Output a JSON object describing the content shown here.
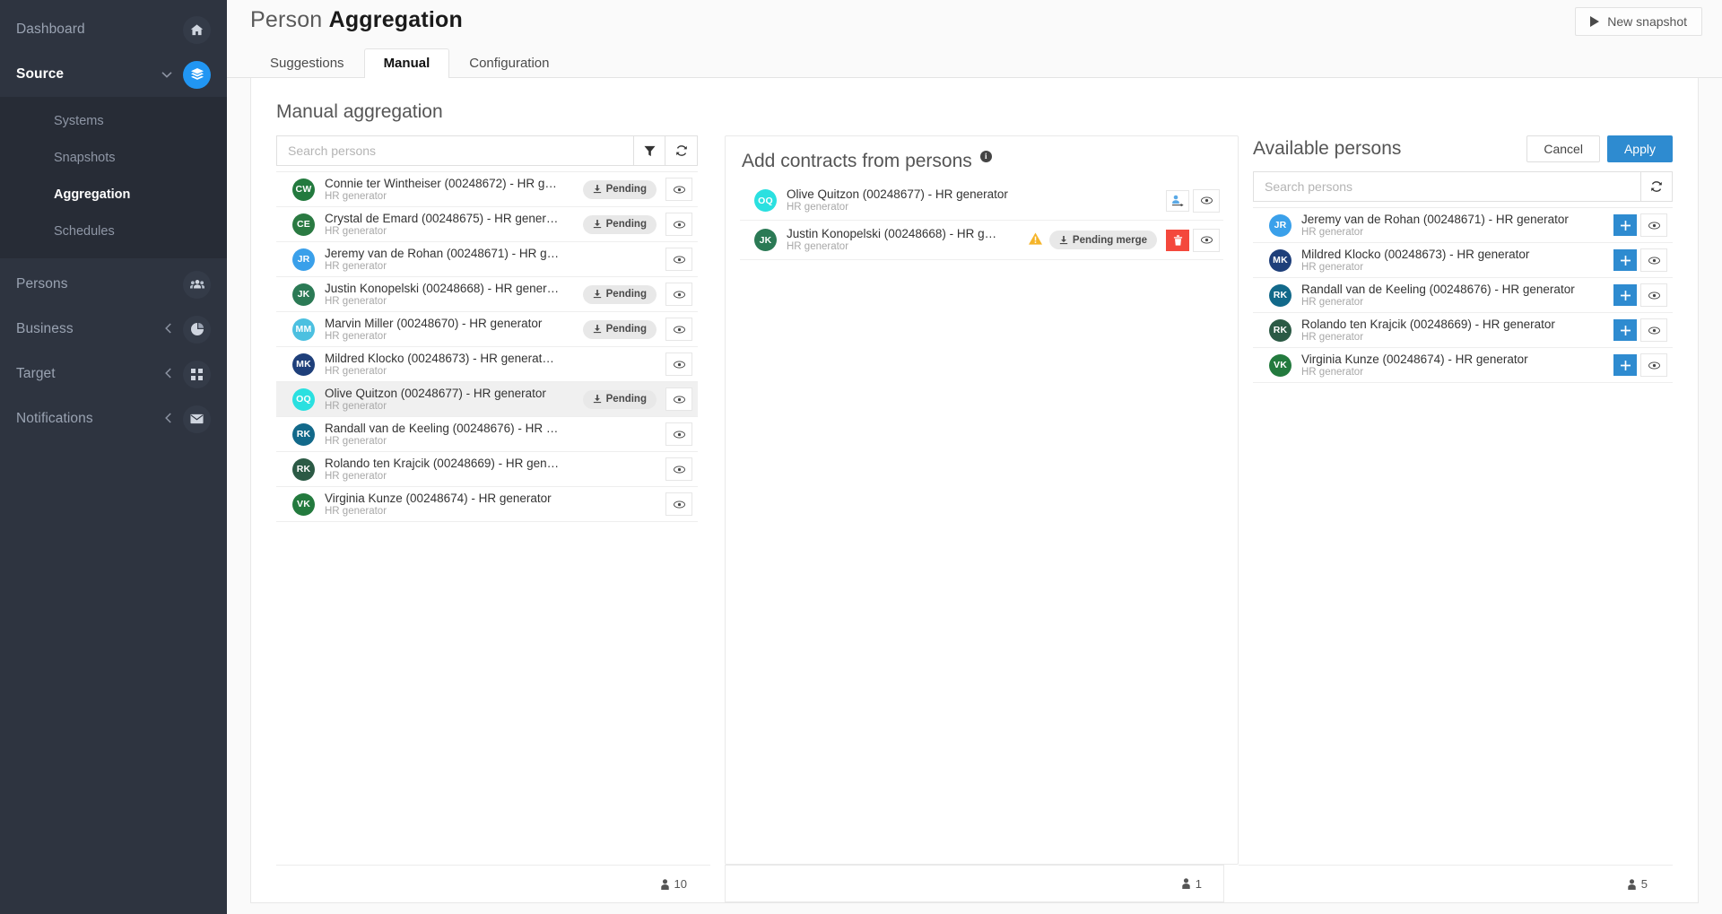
{
  "sidebar": {
    "items": [
      {
        "label": "Dashboard",
        "icon": "home-icon",
        "active": false,
        "expandable": false
      },
      {
        "label": "Source",
        "icon": "layers-icon",
        "active": true,
        "expandable": true,
        "chevron": "down"
      },
      {
        "label": "Persons",
        "icon": "people-icon",
        "active": false,
        "expandable": false
      },
      {
        "label": "Business",
        "icon": "pie-chart-icon",
        "active": false,
        "expandable": true,
        "chevron": "left"
      },
      {
        "label": "Target",
        "icon": "grid-icon",
        "active": false,
        "expandable": true,
        "chevron": "left"
      },
      {
        "label": "Notifications",
        "icon": "envelope-icon",
        "active": false,
        "expandable": true,
        "chevron": "left"
      }
    ],
    "submenu": [
      {
        "label": "Systems",
        "active": false
      },
      {
        "label": "Snapshots",
        "active": false
      },
      {
        "label": "Aggregation",
        "active": true
      },
      {
        "label": "Schedules",
        "active": false
      }
    ],
    "accent_color": "#2196f3",
    "background_color": "#2e3440"
  },
  "header": {
    "title_prefix": "Person ",
    "title_strong": "Aggregation",
    "new_snapshot_label": "New snapshot"
  },
  "tabs": [
    {
      "label": "Suggestions",
      "active": false
    },
    {
      "label": "Manual",
      "active": true
    },
    {
      "label": "Configuration",
      "active": false
    }
  ],
  "content": {
    "title": "Manual aggregation"
  },
  "left_panel": {
    "search_placeholder": "Search persons",
    "search_value": "",
    "filter_icon": "filter-icon",
    "refresh_icon": "refresh-icon",
    "footer_count": "10",
    "rows": [
      {
        "initials": "CW",
        "color": "#237a3e",
        "name": "Connie ter Wintheiser (00248672) - HR g…",
        "sub": "HR generator",
        "badge": "Pending",
        "selected": false
      },
      {
        "initials": "CE",
        "color": "#2a7a42",
        "name": "Crystal de Emard (00248675) - HR gener…",
        "sub": "HR generator",
        "badge": "Pending",
        "selected": false
      },
      {
        "initials": "JR",
        "color": "#3aa0ea",
        "name": "Jeremy van de Rohan (00248671) - HR g…",
        "sub": "HR generator",
        "badge": "",
        "selected": false
      },
      {
        "initials": "JK",
        "color": "#2b7a55",
        "name": "Justin Konopelski (00248668) - HR gener…",
        "sub": "HR generator",
        "badge": "Pending",
        "selected": false
      },
      {
        "initials": "MM",
        "color": "#4cc0e0",
        "name": "Marvin Miller (00248670) - HR generator",
        "sub": "HR generator",
        "badge": "Pending",
        "selected": false
      },
      {
        "initials": "MK",
        "color": "#1e3f7a",
        "name": "Mildred Klocko (00248673) - HR generat…",
        "sub": "HR generator",
        "badge": "",
        "selected": false
      },
      {
        "initials": "OQ",
        "color": "#2ae0e0",
        "name": "Olive Quitzon (00248677) - HR generator",
        "sub": "HR generator",
        "badge": "Pending",
        "selected": true
      },
      {
        "initials": "RK",
        "color": "#12698a",
        "name": "Randall van de Keeling (00248676) - HR …",
        "sub": "HR generator",
        "badge": "",
        "selected": false
      },
      {
        "initials": "RK",
        "color": "#2b5a45",
        "name": "Rolando ten Krajcik (00248669) - HR gen…",
        "sub": "HR generator",
        "badge": "",
        "selected": false
      },
      {
        "initials": "VK",
        "color": "#237a3e",
        "name": "Virginia Kunze (00248674) - HR generator",
        "sub": "HR generator",
        "badge": "",
        "selected": false
      }
    ]
  },
  "mid_panel": {
    "title": "Add contracts from persons",
    "info_glyph": "i",
    "footer_count": "1",
    "rows": [
      {
        "initials": "OQ",
        "color": "#2ae0e0",
        "name": "Olive Quitzon (00248677) - HR generator",
        "sub": "HR generator",
        "badge": "",
        "warn": false,
        "actions": [
          "move-person-icon",
          "eye-icon"
        ]
      },
      {
        "initials": "JK",
        "color": "#2b7a55",
        "name": "Justin Konopelski (00248668) - HR g…",
        "sub": "HR generator",
        "badge": "Pending merge",
        "warn": true,
        "actions": [
          "delete-icon",
          "eye-icon"
        ]
      }
    ]
  },
  "right_panel": {
    "title": "Available persons",
    "cancel_label": "Cancel",
    "apply_label": "Apply",
    "search_placeholder": "Search persons",
    "search_value": "",
    "refresh_icon": "refresh-icon",
    "footer_count": "5",
    "rows": [
      {
        "initials": "JR",
        "color": "#3aa0ea",
        "name": "Jeremy van de Rohan (00248671) - HR generator",
        "sub": "HR generator"
      },
      {
        "initials": "MK",
        "color": "#1e3f7a",
        "name": "Mildred Klocko (00248673) - HR generator",
        "sub": "HR generator"
      },
      {
        "initials": "RK",
        "color": "#12698a",
        "name": "Randall van de Keeling (00248676) - HR generator",
        "sub": "HR generator"
      },
      {
        "initials": "RK",
        "color": "#2b5a45",
        "name": "Rolando ten Krajcik (00248669) - HR generator",
        "sub": "HR generator"
      },
      {
        "initials": "VK",
        "color": "#237a3e",
        "name": "Virginia Kunze (00248674) - HR generator",
        "sub": "HR generator"
      }
    ]
  },
  "colors": {
    "accent_blue": "#2e8bd0",
    "danger_red": "#f4483c",
    "warning_yellow": "#f5b429"
  }
}
